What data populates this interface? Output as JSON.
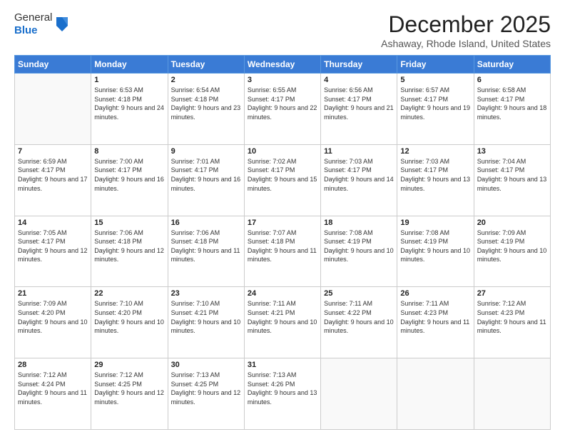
{
  "logo": {
    "general": "General",
    "blue": "Blue"
  },
  "title": "December 2025",
  "subtitle": "Ashaway, Rhode Island, United States",
  "weekdays": [
    "Sunday",
    "Monday",
    "Tuesday",
    "Wednesday",
    "Thursday",
    "Friday",
    "Saturday"
  ],
  "weeks": [
    [
      {
        "day": "",
        "sunrise": "",
        "sunset": "",
        "daylight": "",
        "empty": true
      },
      {
        "day": "1",
        "sunrise": "Sunrise: 6:53 AM",
        "sunset": "Sunset: 4:18 PM",
        "daylight": "Daylight: 9 hours and 24 minutes."
      },
      {
        "day": "2",
        "sunrise": "Sunrise: 6:54 AM",
        "sunset": "Sunset: 4:18 PM",
        "daylight": "Daylight: 9 hours and 23 minutes."
      },
      {
        "day": "3",
        "sunrise": "Sunrise: 6:55 AM",
        "sunset": "Sunset: 4:17 PM",
        "daylight": "Daylight: 9 hours and 22 minutes."
      },
      {
        "day": "4",
        "sunrise": "Sunrise: 6:56 AM",
        "sunset": "Sunset: 4:17 PM",
        "daylight": "Daylight: 9 hours and 21 minutes."
      },
      {
        "day": "5",
        "sunrise": "Sunrise: 6:57 AM",
        "sunset": "Sunset: 4:17 PM",
        "daylight": "Daylight: 9 hours and 19 minutes."
      },
      {
        "day": "6",
        "sunrise": "Sunrise: 6:58 AM",
        "sunset": "Sunset: 4:17 PM",
        "daylight": "Daylight: 9 hours and 18 minutes."
      }
    ],
    [
      {
        "day": "7",
        "sunrise": "Sunrise: 6:59 AM",
        "sunset": "Sunset: 4:17 PM",
        "daylight": "Daylight: 9 hours and 17 minutes."
      },
      {
        "day": "8",
        "sunrise": "Sunrise: 7:00 AM",
        "sunset": "Sunset: 4:17 PM",
        "daylight": "Daylight: 9 hours and 16 minutes."
      },
      {
        "day": "9",
        "sunrise": "Sunrise: 7:01 AM",
        "sunset": "Sunset: 4:17 PM",
        "daylight": "Daylight: 9 hours and 16 minutes."
      },
      {
        "day": "10",
        "sunrise": "Sunrise: 7:02 AM",
        "sunset": "Sunset: 4:17 PM",
        "daylight": "Daylight: 9 hours and 15 minutes."
      },
      {
        "day": "11",
        "sunrise": "Sunrise: 7:03 AM",
        "sunset": "Sunset: 4:17 PM",
        "daylight": "Daylight: 9 hours and 14 minutes."
      },
      {
        "day": "12",
        "sunrise": "Sunrise: 7:03 AM",
        "sunset": "Sunset: 4:17 PM",
        "daylight": "Daylight: 9 hours and 13 minutes."
      },
      {
        "day": "13",
        "sunrise": "Sunrise: 7:04 AM",
        "sunset": "Sunset: 4:17 PM",
        "daylight": "Daylight: 9 hours and 13 minutes."
      }
    ],
    [
      {
        "day": "14",
        "sunrise": "Sunrise: 7:05 AM",
        "sunset": "Sunset: 4:17 PM",
        "daylight": "Daylight: 9 hours and 12 minutes."
      },
      {
        "day": "15",
        "sunrise": "Sunrise: 7:06 AM",
        "sunset": "Sunset: 4:18 PM",
        "daylight": "Daylight: 9 hours and 12 minutes."
      },
      {
        "day": "16",
        "sunrise": "Sunrise: 7:06 AM",
        "sunset": "Sunset: 4:18 PM",
        "daylight": "Daylight: 9 hours and 11 minutes."
      },
      {
        "day": "17",
        "sunrise": "Sunrise: 7:07 AM",
        "sunset": "Sunset: 4:18 PM",
        "daylight": "Daylight: 9 hours and 11 minutes."
      },
      {
        "day": "18",
        "sunrise": "Sunrise: 7:08 AM",
        "sunset": "Sunset: 4:19 PM",
        "daylight": "Daylight: 9 hours and 10 minutes."
      },
      {
        "day": "19",
        "sunrise": "Sunrise: 7:08 AM",
        "sunset": "Sunset: 4:19 PM",
        "daylight": "Daylight: 9 hours and 10 minutes."
      },
      {
        "day": "20",
        "sunrise": "Sunrise: 7:09 AM",
        "sunset": "Sunset: 4:19 PM",
        "daylight": "Daylight: 9 hours and 10 minutes."
      }
    ],
    [
      {
        "day": "21",
        "sunrise": "Sunrise: 7:09 AM",
        "sunset": "Sunset: 4:20 PM",
        "daylight": "Daylight: 9 hours and 10 minutes."
      },
      {
        "day": "22",
        "sunrise": "Sunrise: 7:10 AM",
        "sunset": "Sunset: 4:20 PM",
        "daylight": "Daylight: 9 hours and 10 minutes."
      },
      {
        "day": "23",
        "sunrise": "Sunrise: 7:10 AM",
        "sunset": "Sunset: 4:21 PM",
        "daylight": "Daylight: 9 hours and 10 minutes."
      },
      {
        "day": "24",
        "sunrise": "Sunrise: 7:11 AM",
        "sunset": "Sunset: 4:21 PM",
        "daylight": "Daylight: 9 hours and 10 minutes."
      },
      {
        "day": "25",
        "sunrise": "Sunrise: 7:11 AM",
        "sunset": "Sunset: 4:22 PM",
        "daylight": "Daylight: 9 hours and 10 minutes."
      },
      {
        "day": "26",
        "sunrise": "Sunrise: 7:11 AM",
        "sunset": "Sunset: 4:23 PM",
        "daylight": "Daylight: 9 hours and 11 minutes."
      },
      {
        "day": "27",
        "sunrise": "Sunrise: 7:12 AM",
        "sunset": "Sunset: 4:23 PM",
        "daylight": "Daylight: 9 hours and 11 minutes."
      }
    ],
    [
      {
        "day": "28",
        "sunrise": "Sunrise: 7:12 AM",
        "sunset": "Sunset: 4:24 PM",
        "daylight": "Daylight: 9 hours and 11 minutes."
      },
      {
        "day": "29",
        "sunrise": "Sunrise: 7:12 AM",
        "sunset": "Sunset: 4:25 PM",
        "daylight": "Daylight: 9 hours and 12 minutes."
      },
      {
        "day": "30",
        "sunrise": "Sunrise: 7:13 AM",
        "sunset": "Sunset: 4:25 PM",
        "daylight": "Daylight: 9 hours and 12 minutes."
      },
      {
        "day": "31",
        "sunrise": "Sunrise: 7:13 AM",
        "sunset": "Sunset: 4:26 PM",
        "daylight": "Daylight: 9 hours and 13 minutes."
      },
      {
        "day": "",
        "sunrise": "",
        "sunset": "",
        "daylight": "",
        "empty": true
      },
      {
        "day": "",
        "sunrise": "",
        "sunset": "",
        "daylight": "",
        "empty": true
      },
      {
        "day": "",
        "sunrise": "",
        "sunset": "",
        "daylight": "",
        "empty": true
      }
    ]
  ]
}
